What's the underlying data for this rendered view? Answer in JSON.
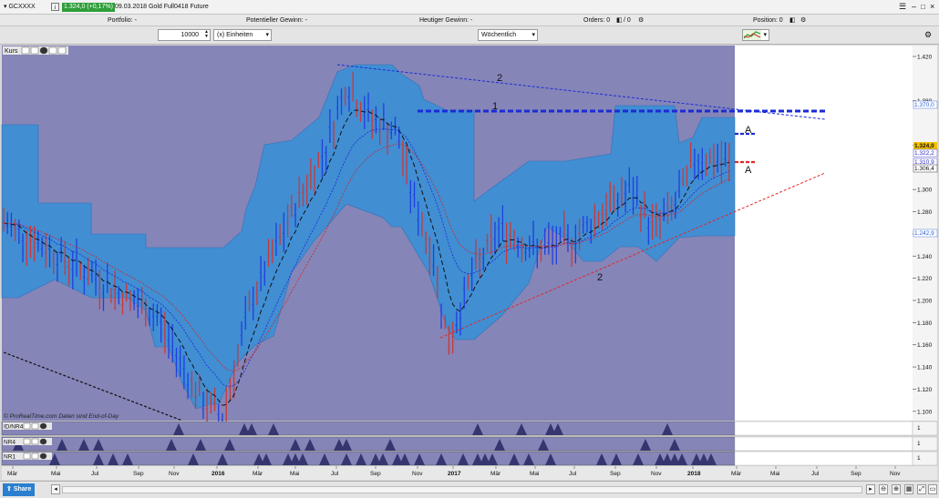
{
  "window": {
    "symbol": "GCXXXX",
    "price_change": "1.324,0 (+0,17%)",
    "date_contract": "09.03.2018 Gold Full0418 Future"
  },
  "infobar": {
    "portfolio": "Portfolio: -",
    "potential_gain": "Potentieller Gewinn: -",
    "todays_gain": "Heutiger Gewinn: -",
    "orders": "Orders: 0",
    "orders_b": "/ 0",
    "position": "Position: 0"
  },
  "controls": {
    "quantity": "10000",
    "units": "(x) Einheiten",
    "timeframe": "Wöchentlich"
  },
  "chart": {
    "panel_label": "Kurs",
    "footer_note": "© ProRealTime.com  Daten sind End-of-Day",
    "price_axis": [
      "1.420",
      "1.380",
      "1.340",
      "1.300",
      "1.280",
      "1.260",
      "1.240",
      "1.220",
      "1.200",
      "1.180",
      "1.160",
      "1.140",
      "1.120",
      "1.100"
    ],
    "price_labels": [
      {
        "text": "1.370,0",
        "color": "#2a5bd7"
      },
      {
        "text": "1.324,0",
        "color": "#111111",
        "bg": "#f2c200"
      },
      {
        "text": "1.322,2",
        "color": "#2a2ac8"
      },
      {
        "text": "1.310,9",
        "color": "#2a2ac8"
      },
      {
        "text": "1.306,4",
        "color": "#111111"
      },
      {
        "text": "1.242,9",
        "color": "#2a5bd7"
      }
    ],
    "annotations": {
      "line1": "1",
      "line2_top": "2",
      "line2_bottom": "2",
      "a_top": "A",
      "a_bottom": "A"
    },
    "time_axis": [
      "Mär",
      "Mai",
      "Jul",
      "Sep",
      "Nov",
      "2016",
      "Mär",
      "Mai",
      "Jul",
      "Sep",
      "Nov",
      "2017",
      "Mär",
      "Mai",
      "Jul",
      "Sep",
      "Nov",
      "2018",
      "Mär",
      "Mai",
      "Jul",
      "Sep",
      "Nov"
    ],
    "indicators": [
      {
        "label": "ID/NR4",
        "value": "1"
      },
      {
        "label": "NR4",
        "value": "1"
      },
      {
        "label": "NR1",
        "value": "1"
      }
    ],
    "colors": {
      "panel_bg": "#8585b8",
      "future_bg": "#ffffff",
      "cloud": "#3c8fd6",
      "up": "#1f3fe0",
      "down": "#c83a3a",
      "trend_blue": "#1a2bd6",
      "trend_red": "#e52727"
    }
  },
  "bottombar": {
    "share": "Share"
  }
}
